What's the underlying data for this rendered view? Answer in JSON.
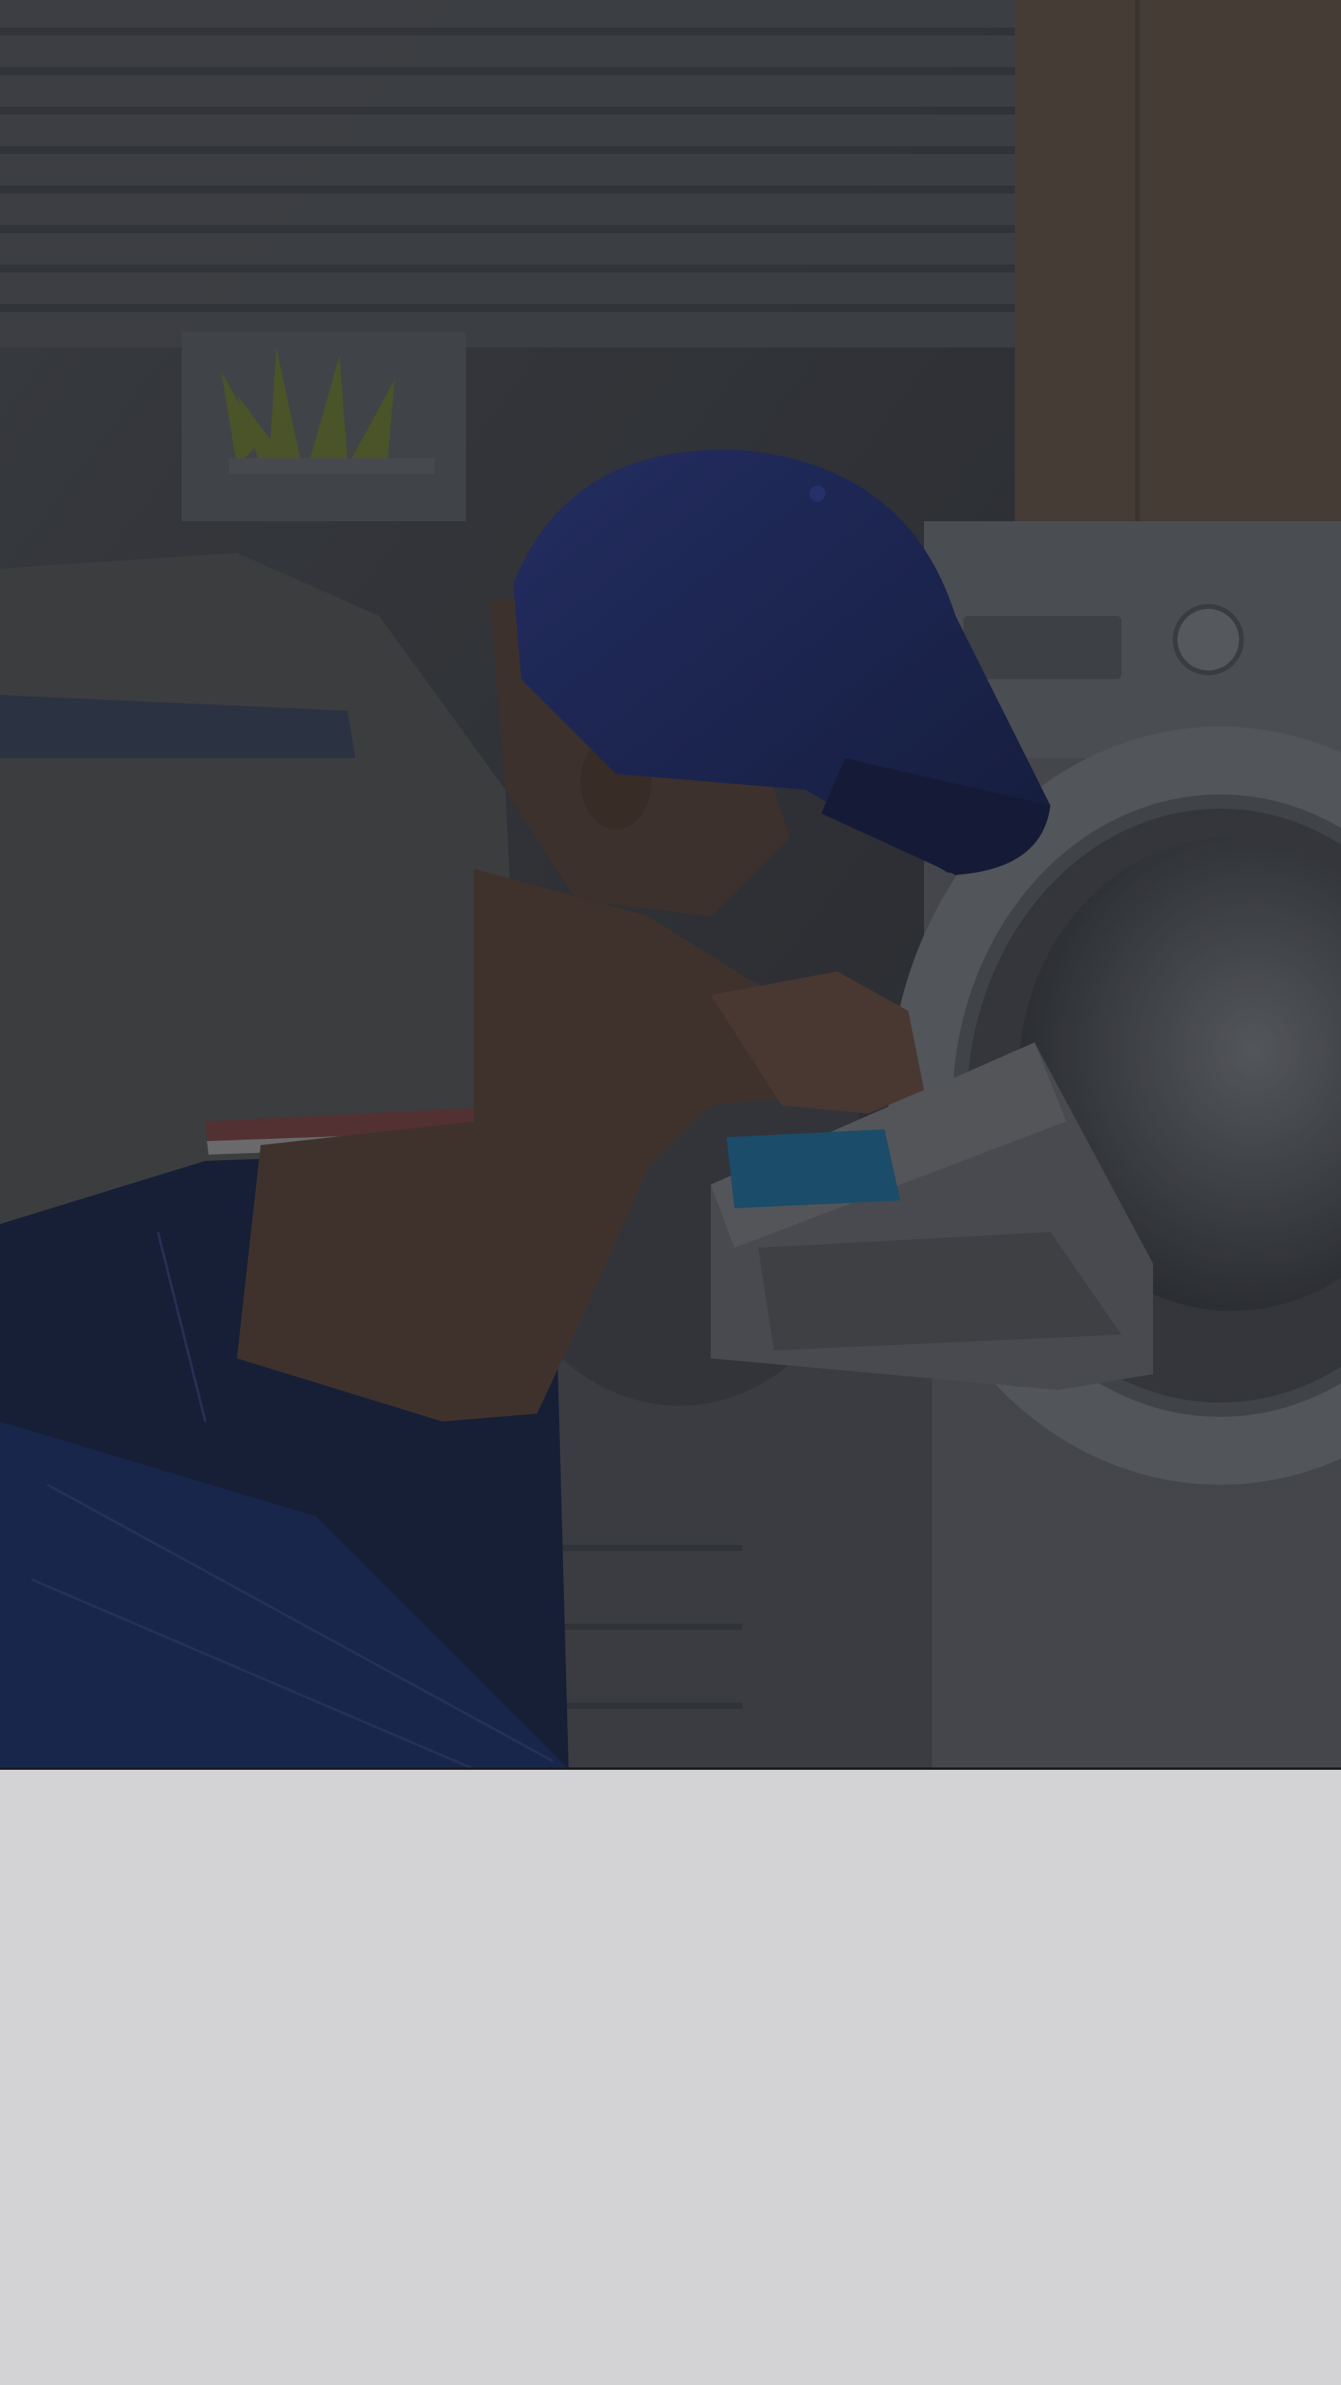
{
  "hero": {
    "image_subject": "technician-repairing-washing-machine",
    "overlay_color": "#1a1b20"
  },
  "colors": {
    "cap": "#1f2a5c",
    "overalls": "#16213f",
    "shirt": "#4a4a4c",
    "machine": "#5b5d63",
    "detergent_tray_accent": "#1c5f86",
    "lower_panel": "#d3d2d4"
  }
}
